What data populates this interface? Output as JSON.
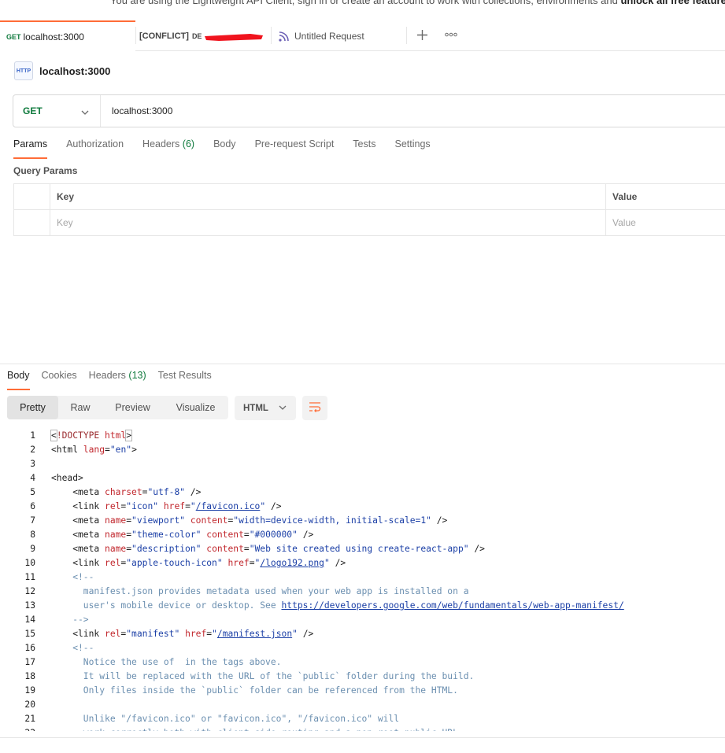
{
  "banner": {
    "text_prefix": "You are using the Lightweight API Client, sign in or create an account to work with collections, environments and ",
    "text_bold": "unlock all free features in"
  },
  "tabs": [
    {
      "method": "GET",
      "label": "localhost:3000",
      "active": true
    },
    {
      "prefix": "[CONFLICT]",
      "label": "DE",
      "active": false
    },
    {
      "label": "Untitled Request",
      "active": false
    }
  ],
  "tab_actions": {
    "add_icon": "plus-icon",
    "more_icon": "more-horizontal-icon"
  },
  "request": {
    "badge": "HTTP",
    "title": "localhost:3000",
    "method": "GET",
    "url": "localhost:3000"
  },
  "request_tabs": {
    "params": "Params",
    "authorization": "Authorization",
    "headers": "Headers",
    "headers_count": "(6)",
    "body": "Body",
    "pre_request": "Pre-request Script",
    "tests": "Tests",
    "settings": "Settings"
  },
  "query_params": {
    "title": "Query Params",
    "key_header": "Key",
    "value_header": "Value",
    "key_placeholder": "Key",
    "value_placeholder": "Value"
  },
  "response_tabs": {
    "body": "Body",
    "cookies": "Cookies",
    "headers": "Headers",
    "headers_count": "(13)",
    "test_results": "Test Results"
  },
  "view_modes": [
    "Pretty",
    "Raw",
    "Preview",
    "Visualize"
  ],
  "language": "HTML",
  "colors": {
    "accent": "#ff6c37",
    "method_green": "#0f7a3d"
  },
  "code_lines": [
    [
      [
        "<",
        "k-brk"
      ],
      [
        "!DOCTYPE ",
        "k-doc"
      ],
      [
        "html",
        "k-attr"
      ],
      [
        ">",
        "k-brk"
      ]
    ],
    [
      [
        "<html ",
        "k-tag"
      ],
      [
        "lang",
        "k-attr"
      ],
      [
        "=",
        "k-tag"
      ],
      [
        "\"en\"",
        "k-str"
      ],
      [
        ">",
        "k-tag"
      ]
    ],
    [],
    [
      [
        "<head>",
        "k-tag"
      ]
    ],
    [
      [
        "    <meta ",
        "k-tag"
      ],
      [
        "charset",
        "k-attr"
      ],
      [
        "=",
        "k-tag"
      ],
      [
        "\"utf-8\"",
        "k-str"
      ],
      [
        " />",
        "k-tag"
      ]
    ],
    [
      [
        "    <link ",
        "k-tag"
      ],
      [
        "rel",
        "k-attr"
      ],
      [
        "=",
        "k-tag"
      ],
      [
        "\"icon\"",
        "k-str"
      ],
      [
        " ",
        "k-tag"
      ],
      [
        "href",
        "k-attr"
      ],
      [
        "=",
        "k-tag"
      ],
      [
        "\"",
        "k-str"
      ],
      [
        "/favicon.ico",
        "k-link"
      ],
      [
        "\"",
        "k-str"
      ],
      [
        " />",
        "k-tag"
      ]
    ],
    [
      [
        "    <meta ",
        "k-tag"
      ],
      [
        "name",
        "k-attr"
      ],
      [
        "=",
        "k-tag"
      ],
      [
        "\"viewport\"",
        "k-str"
      ],
      [
        " ",
        "k-tag"
      ],
      [
        "content",
        "k-attr"
      ],
      [
        "=",
        "k-tag"
      ],
      [
        "\"width=device-width, initial-scale=1\"",
        "k-str"
      ],
      [
        " />",
        "k-tag"
      ]
    ],
    [
      [
        "    <meta ",
        "k-tag"
      ],
      [
        "name",
        "k-attr"
      ],
      [
        "=",
        "k-tag"
      ],
      [
        "\"theme-color\"",
        "k-str"
      ],
      [
        " ",
        "k-tag"
      ],
      [
        "content",
        "k-attr"
      ],
      [
        "=",
        "k-tag"
      ],
      [
        "\"#000000\"",
        "k-str"
      ],
      [
        " />",
        "k-tag"
      ]
    ],
    [
      [
        "    <meta ",
        "k-tag"
      ],
      [
        "name",
        "k-attr"
      ],
      [
        "=",
        "k-tag"
      ],
      [
        "\"description\"",
        "k-str"
      ],
      [
        " ",
        "k-tag"
      ],
      [
        "content",
        "k-attr"
      ],
      [
        "=",
        "k-tag"
      ],
      [
        "\"Web site created using create-react-app\"",
        "k-str"
      ],
      [
        " />",
        "k-tag"
      ]
    ],
    [
      [
        "    <link ",
        "k-tag"
      ],
      [
        "rel",
        "k-attr"
      ],
      [
        "=",
        "k-tag"
      ],
      [
        "\"apple-touch-icon\"",
        "k-str"
      ],
      [
        " ",
        "k-tag"
      ],
      [
        "href",
        "k-attr"
      ],
      [
        "=",
        "k-tag"
      ],
      [
        "\"",
        "k-str"
      ],
      [
        "/logo192.png",
        "k-link"
      ],
      [
        "\"",
        "k-str"
      ],
      [
        " />",
        "k-tag"
      ]
    ],
    [
      [
        "    <!--",
        "k-com"
      ]
    ],
    [
      [
        "      manifest.json provides metadata used when your web app is installed on a",
        "k-com"
      ]
    ],
    [
      [
        "      user's mobile device or desktop. See ",
        "k-com"
      ],
      [
        "https://developers.google.com/web/fundamentals/web-app-manifest/",
        "k-link"
      ]
    ],
    [
      [
        "    -->",
        "k-com"
      ]
    ],
    [
      [
        "    <link ",
        "k-tag"
      ],
      [
        "rel",
        "k-attr"
      ],
      [
        "=",
        "k-tag"
      ],
      [
        "\"manifest\"",
        "k-str"
      ],
      [
        " ",
        "k-tag"
      ],
      [
        "href",
        "k-attr"
      ],
      [
        "=",
        "k-tag"
      ],
      [
        "\"",
        "k-str"
      ],
      [
        "/manifest.json",
        "k-link"
      ],
      [
        "\"",
        "k-str"
      ],
      [
        " />",
        "k-tag"
      ]
    ],
    [
      [
        "    <!--",
        "k-com"
      ]
    ],
    [
      [
        "      Notice the use of  in the tags above.",
        "k-com"
      ]
    ],
    [
      [
        "      It will be replaced with the URL of the `public` folder during the build.",
        "k-com"
      ]
    ],
    [
      [
        "      Only files inside the `public` folder can be referenced from the HTML.",
        "k-com"
      ]
    ],
    [],
    [
      [
        "      Unlike \"/favicon.ico\" or \"favicon.ico\", \"/favicon.ico\" will",
        "k-com"
      ]
    ],
    [
      [
        "      work correctly both with client-side routing and a non-root public URL.",
        "k-com"
      ]
    ]
  ]
}
